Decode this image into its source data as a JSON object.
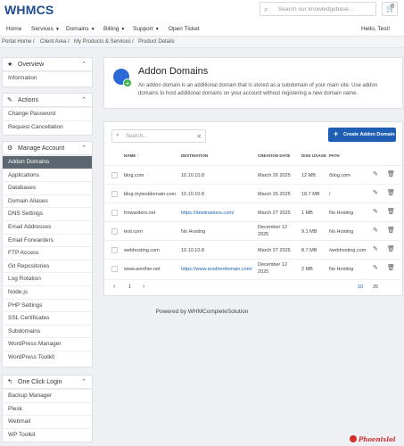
{
  "header": {
    "logo_text": "WHMCS",
    "search_placeholder": "Search our knowledgebase...",
    "cart_count": "0"
  },
  "nav": {
    "items": [
      {
        "label": "Home"
      },
      {
        "label": "Services"
      },
      {
        "label": "Domains"
      },
      {
        "label": "Billing"
      },
      {
        "label": "Support"
      },
      {
        "label": "Open Ticket"
      }
    ],
    "user_greeting": "Hello, Test!"
  },
  "breadcrumb": [
    "Portal Home",
    "Client Area",
    "My Products & Services",
    "Product Details"
  ],
  "sidebar": {
    "overview": {
      "title": "Overview",
      "items": [
        "Information"
      ]
    },
    "actions": {
      "title": "Actions",
      "items": [
        "Change Password",
        "Request Cancellation"
      ]
    },
    "manage": {
      "title": "Manage Account",
      "items": [
        "Addon Domains",
        "Applications",
        "Databases",
        "Domain Aliases",
        "DNS Settings",
        "Email Addresses",
        "Email Forwarders",
        "FTP Access",
        "Git Repositories",
        "Log Rotation",
        "Node.js",
        "PHP Settings",
        "SSL Certificates",
        "Subdomains",
        "WordPress Manager",
        "WordPress Toolkit"
      ],
      "active_index": 0
    },
    "oneclick": {
      "title": "One Click Login",
      "items": [
        "Backup Manager",
        "Plesk",
        "Webmail",
        "WP Toolkit"
      ]
    }
  },
  "page": {
    "title": "Addon Domains",
    "description": "An addon domain is an additional domain that is stored as a subdomain of your main site. Use addon domains to host additional domains on your account without registering a new domain name."
  },
  "table": {
    "search_placeholder": "Search...",
    "create_label": "Create Addon Domain",
    "columns": [
      "NAME",
      "DESTINATION",
      "CREATION DATE",
      "DISK USAGE",
      "PATH"
    ],
    "rows": [
      {
        "name": "blog.com",
        "destination": "10.10.10.8",
        "date": "March 26 2025",
        "disk": "12 MB",
        "path": "/blog.com"
      },
      {
        "name": "blog.mytestdomain.com",
        "destination": "10.10.10.8",
        "date": "March 26 2025",
        "disk": "18.7 MB",
        "path": "/"
      },
      {
        "name": "forwarders.net",
        "destination": "https://destinations.com/",
        "date": "March 27 2025",
        "disk": "1 MB",
        "path": "No Hosting"
      },
      {
        "name": "test.com",
        "destination": "No Hosting",
        "date": "December 12 2025",
        "disk": "9.1 MB",
        "path": "No Hosting"
      },
      {
        "name": "webhosting.com",
        "destination": "10.10.10.8",
        "date": "March 27 2025",
        "disk": "8.7 MB",
        "path": "/webhosting.com"
      },
      {
        "name": "www.another.net",
        "destination": "https://www.anotherdomain.com/",
        "date": "December 12 2025",
        "disk": "2 MB",
        "path": "No Hosting"
      }
    ],
    "pagination": {
      "prev": "‹",
      "page": "1",
      "next": "›",
      "size_a": "10",
      "size_b": "25"
    }
  },
  "footer": {
    "powered_by": "Powered by WHMCompleteSolution",
    "brand": "Phoenixlol"
  }
}
